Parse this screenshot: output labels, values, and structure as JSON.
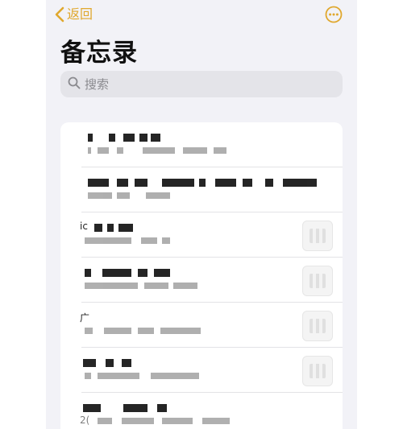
{
  "nav": {
    "back_label": "返回",
    "more_icon": "ellipsis-circle-icon",
    "accent_color": "#e0a82e"
  },
  "page": {
    "title": "备忘录"
  },
  "search": {
    "placeholder": "搜索",
    "icon": "search-icon"
  },
  "notes": [
    {
      "prefix": "",
      "has_thumbnail": false
    },
    {
      "prefix": "",
      "has_thumbnail": false
    },
    {
      "prefix": "ic",
      "has_thumbnail": true
    },
    {
      "prefix": "",
      "has_thumbnail": true
    },
    {
      "prefix": "广",
      "has_thumbnail": true
    },
    {
      "prefix": "",
      "has_thumbnail": true
    },
    {
      "prefix": "2(",
      "has_thumbnail": false
    }
  ]
}
